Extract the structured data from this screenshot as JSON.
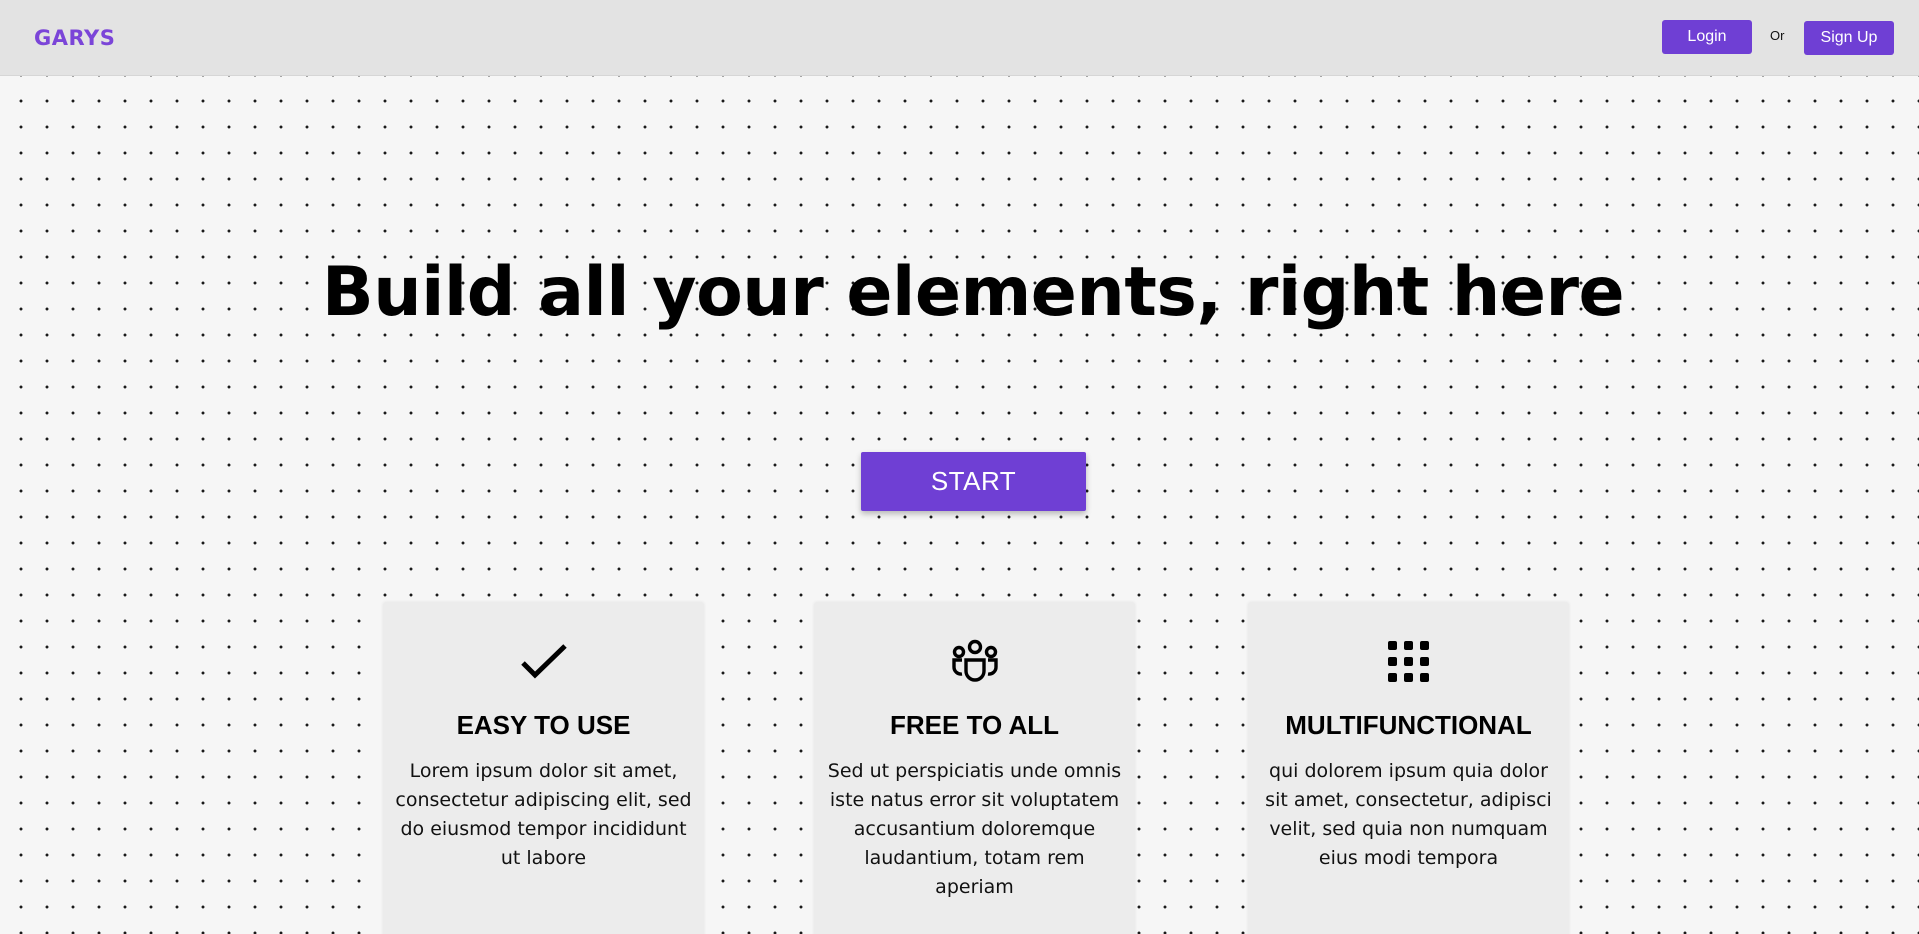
{
  "brand": {
    "name": "GARYS"
  },
  "nav": {
    "login_label": "Login",
    "or_label": "Or",
    "signup_label": "Sign Up"
  },
  "hero": {
    "title": "Build all your elements, right here",
    "start_label": "START"
  },
  "features": [
    {
      "icon": "checkmark-icon",
      "title": "EASY TO USE",
      "text": "Lorem ipsum dolor sit amet, consectetur adipiscing elit, sed do eiusmod tempor incididunt ut labore"
    },
    {
      "icon": "people-group-icon",
      "title": "FREE TO ALL",
      "text": "Sed ut perspiciatis unde omnis iste natus error sit voluptatem accusantium doloremque laudantium, totam rem aperiam"
    },
    {
      "icon": "grid-dots-icon",
      "title": "MULTIFUNCTIONAL",
      "text": "qui dolorem ipsum quia dolor sit amet, consectetur, adipisci velit, sed quia non numquam eius modi tempora"
    }
  ],
  "colors": {
    "accent": "#6f3fd4",
    "brand": "#7b45d8",
    "navbar_bg": "#e3e3e3",
    "card_bg": "#ececec",
    "page_bg": "#f6f6f6"
  }
}
